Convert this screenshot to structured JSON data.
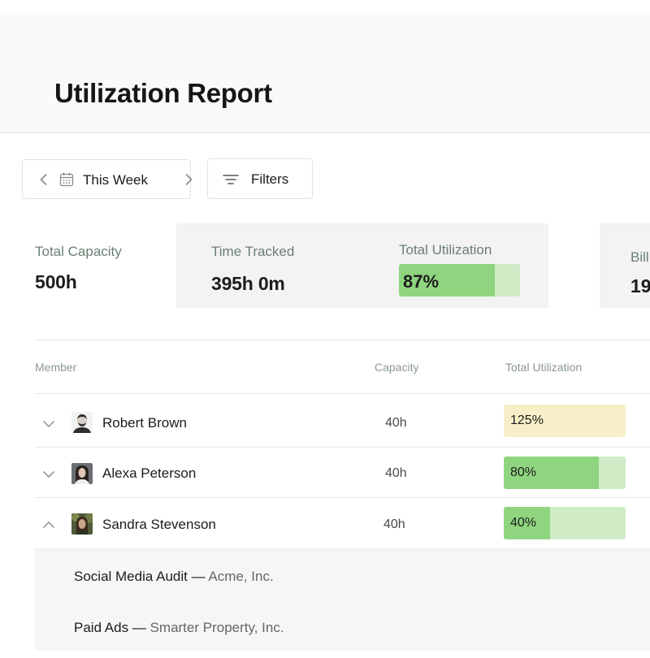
{
  "header": {
    "title": "Utilization Report"
  },
  "toolbar": {
    "week_label": "This Week",
    "filters_label": "Filters"
  },
  "summary": {
    "total_capacity_label": "Total Capacity",
    "total_capacity_value": "500h",
    "time_tracked_label": "Time Tracked",
    "time_tracked_value": "395h 0m",
    "total_utilization_label": "Total Utilization",
    "total_utilization_value": "87%",
    "total_utilization_fill": 0.79,
    "billable_label_partial": "Bill",
    "billable_value_partial": "19"
  },
  "table": {
    "columns": {
      "member": "Member",
      "capacity": "Capacity",
      "utilization": "Total Utilization"
    },
    "rows": [
      {
        "name": "Robert Brown",
        "capacity": "40h",
        "utilization": "125%",
        "fill": 1.0,
        "state": "over",
        "expanded": false
      },
      {
        "name": "Alexa Peterson",
        "capacity": "40h",
        "utilization": "80%",
        "fill": 0.78,
        "state": "normal",
        "expanded": false
      },
      {
        "name": "Sandra Stevenson",
        "capacity": "40h",
        "utilization": "40%",
        "fill": 0.38,
        "state": "normal",
        "expanded": true
      }
    ],
    "sub_rows": [
      {
        "task": "Social Media Audit",
        "separator": " — ",
        "client": "Acme, Inc."
      },
      {
        "task": "Paid Ads",
        "separator": " — ",
        "client": "Smarter Property, Inc."
      }
    ]
  },
  "colors": {
    "util_fill": "#8fd57f",
    "util_track": "#cfecc6",
    "over_fill": "#f8efc8"
  }
}
